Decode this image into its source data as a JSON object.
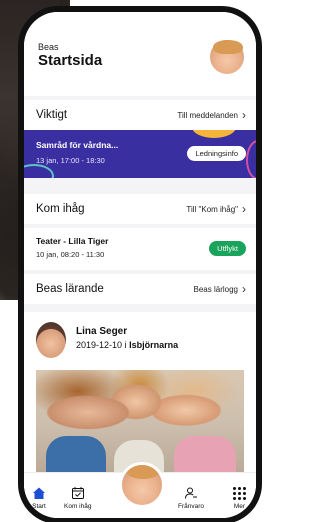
{
  "header": {
    "subtitle": "Beas",
    "title": "Startsida"
  },
  "viktigt": {
    "title": "Viktigt",
    "link": "Till meddelanden"
  },
  "important_event": {
    "title": "Samråd för vårdna...",
    "time": "13 jan, 17:00 - 18:30",
    "tag": "Ledningsinfo"
  },
  "kom_ihag": {
    "title": "Kom ihåg",
    "link": "Till \"Kom ihåg\""
  },
  "reminder_event": {
    "title": "Teater - Lilla Tiger",
    "time": "10 jan, 08:20 - 11:30",
    "tag": "Utflykt"
  },
  "larande": {
    "title": "Beas lärande",
    "link": "Beas lärlogg"
  },
  "post": {
    "author": "Lina Seger",
    "date": "2019-12-10 i",
    "group": "Isbjörnarna"
  },
  "nav": {
    "home": "Start",
    "kom_ihag": "Kom ihåg",
    "absence": "Frånvaro",
    "more": "Mer"
  },
  "colors": {
    "accent": "#3a2fa0",
    "green_tag": "#1aa35a",
    "nav_active": "#1c4fd4"
  },
  "icons": {
    "home": "home-icon",
    "calendar": "calendar-check-icon",
    "absence": "person-absence-icon",
    "more": "grid-menu-icon",
    "chevron": "chevron-right-icon"
  }
}
